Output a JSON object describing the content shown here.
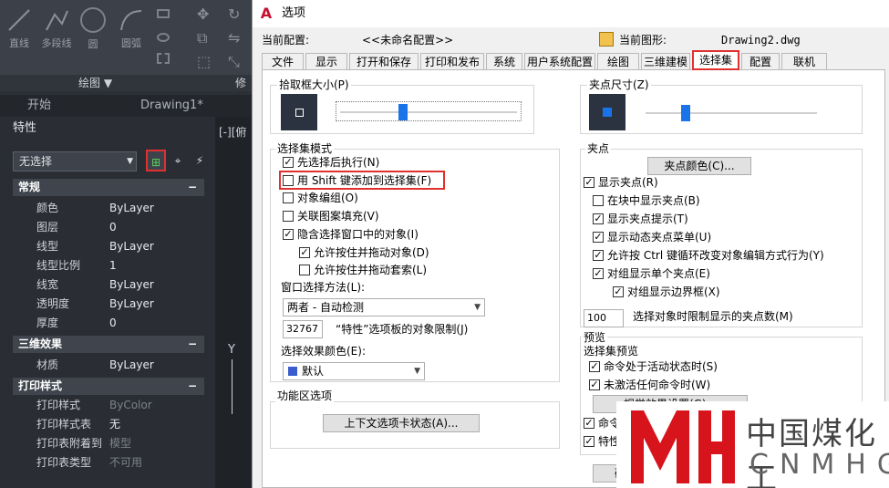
{
  "app": {
    "ribbon_tools": [
      "直线",
      "多段线",
      "圆",
      "圆弧"
    ],
    "panel_label": "绘图 ▼",
    "panel_label2": "修",
    "doc_tabs": [
      "开始",
      "Drawing1*"
    ],
    "properties": {
      "title": "特性",
      "selection": "无选择",
      "viewport_label": "[-][俯",
      "sections": [
        {
          "name": "常规",
          "rows": [
            [
              "颜色",
              "ByLayer"
            ],
            [
              "图层",
              "0"
            ],
            [
              "线型",
              "ByLayer"
            ],
            [
              "线型比例",
              "1"
            ],
            [
              "线宽",
              "ByLayer"
            ],
            [
              "透明度",
              "ByLayer"
            ],
            [
              "厚度",
              "0"
            ]
          ]
        },
        {
          "name": "三维效果",
          "rows": [
            [
              "材质",
              "ByLayer"
            ]
          ]
        },
        {
          "name": "打印样式",
          "rows": [
            [
              "打印样式",
              "ByColor"
            ],
            [
              "打印样式表",
              "无"
            ],
            [
              "打印表附着到",
              "模型"
            ],
            [
              "打印表类型",
              "不可用"
            ]
          ]
        }
      ],
      "axis_label": "Y"
    }
  },
  "dialog": {
    "title": "选项",
    "logo": "A",
    "current_profile_label": "当前配置:",
    "current_profile_value": "<<未命名配置>>",
    "current_drawing_label": "当前图形:",
    "current_drawing_value": "Drawing2.dwg",
    "tabs": [
      "文件",
      "显示",
      "打开和保存",
      "打印和发布",
      "系统",
      "用户系统配置",
      "绘图",
      "三维建模",
      "选择集",
      "配置",
      "联机"
    ],
    "active_tab": "选择集",
    "pickbox": {
      "label": "拾取框大小(P)",
      "level": 0.35
    },
    "gripsize": {
      "label": "夹点尺寸(Z)",
      "level": 0.22
    },
    "selection_modes": {
      "label": "选择集模式",
      "items": [
        {
          "label": "先选择后执行(N)",
          "checked": true
        },
        {
          "label": "用 Shift 键添加到选择集(F)",
          "checked": false
        },
        {
          "label": "对象编组(O)",
          "checked": false
        },
        {
          "label": "关联图案填充(V)",
          "checked": false
        },
        {
          "label": "隐含选择窗口中的对象(I)",
          "checked": true
        },
        {
          "label": "允许按住并拖动对象(D)",
          "checked": true
        },
        {
          "label": "允许按住并拖动套索(L)",
          "checked": false
        }
      ],
      "window_method_label": "窗口选择方法(L):",
      "window_method_value": "两者 - 自动检测",
      "limit_value": "32767",
      "limit_label": "“特性”选项板的对象限制(J)",
      "effect_color_label": "选择效果颜色(E):",
      "effect_color_value": "默认"
    },
    "ribbon_options": {
      "label": "功能区选项",
      "button": "上下文选项卡状态(A)..."
    },
    "grips": {
      "label": "夹点",
      "color_button": "夹点颜色(C)...",
      "items": [
        {
          "label": "显示夹点(R)",
          "checked": true
        },
        {
          "label": "在块中显示夹点(B)",
          "checked": false
        },
        {
          "label": "显示夹点提示(T)",
          "checked": true
        },
        {
          "label": "显示动态夹点菜单(U)",
          "checked": true
        },
        {
          "label": "允许按 Ctrl 键循环改变对象编辑方式行为(Y)",
          "checked": true
        },
        {
          "label": "对组显示单个夹点(E)",
          "checked": true
        },
        {
          "label": "对组显示边界框(X)",
          "checked": true
        }
      ],
      "limit_value": "100",
      "limit_label": "选择对象时限制显示的夹点数(M)"
    },
    "preview": {
      "label": "预览",
      "sublabel": "选择集预览",
      "items": [
        {
          "label": "命令处于活动状态时(S)",
          "checked": true
        },
        {
          "label": "未激活任何命令时(W)",
          "checked": true
        }
      ],
      "effect_button": "视觉效果设置(G)...",
      "partial_items": [
        "命令",
        "特性"
      ],
      "ok_partial": "确"
    }
  },
  "watermark": {
    "mark": "YH",
    "cn": "中国煤化工",
    "en": "CNMHG",
    "brand_color": "#d7141c"
  },
  "colors": {
    "highlight": "#e03131",
    "accent": "#1a73e8"
  }
}
